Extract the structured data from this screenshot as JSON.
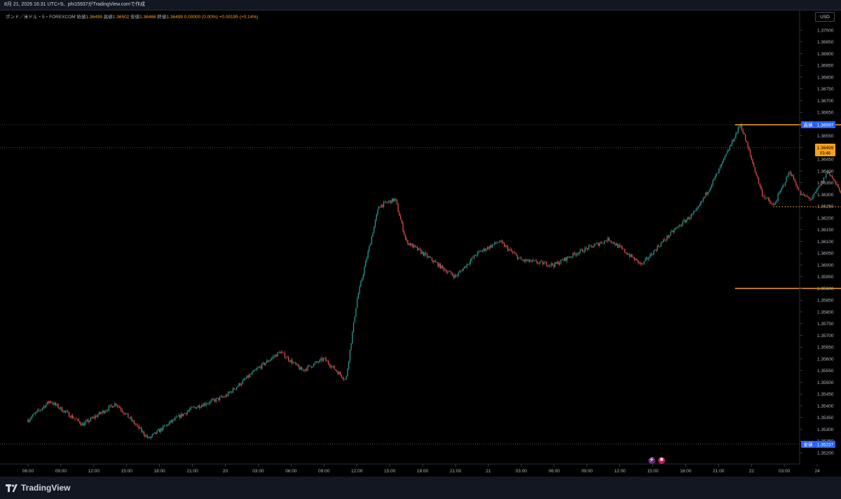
{
  "header": {
    "caption": "8月 21, 2026 16:31 UTC+9、phi15937がTradingView.comで作成"
  },
  "legend": {
    "symbol": "ポンド／米ドル・5・FOREXCOM",
    "open_label": "始値",
    "open": "1.36499",
    "high_label": "高値",
    "high": "1.36502",
    "low_label": "安値",
    "low": "1.36466",
    "close_label": "終値",
    "close": "1.36499",
    "change": "0.00000 (0.00%)",
    "change2": "+0.00195 (+0.14%)"
  },
  "price_scale": {
    "currency": "USD"
  },
  "markers": {
    "high_label": "高値",
    "high_value": "1.36597",
    "low_label": "安値",
    "low_value": "1.35237",
    "last_value": "1.36499",
    "countdown": "03:46"
  },
  "footer": {
    "logo_text": "TradingView"
  },
  "colors": {
    "up": "#26a69a",
    "down": "#ef5350",
    "accent": "#f7a21b",
    "marker": "#2962ff"
  },
  "chart_data": {
    "type": "candlestick",
    "title": "ポンド／米ドル・5・FOREXCOM",
    "y_ticks": [
      "1.37000",
      "1.36950",
      "1.36900",
      "1.36850",
      "1.36800",
      "1.36750",
      "1.36700",
      "1.36650",
      "1.36600",
      "1.36550",
      "1.36500",
      "1.36450",
      "1.36400",
      "1.36350",
      "1.36300",
      "1.36250",
      "1.36200",
      "1.36150",
      "1.36100",
      "1.36050",
      "1.36000",
      "1.35950",
      "1.35900",
      "1.35850",
      "1.35800",
      "1.35750",
      "1.35700",
      "1.35650",
      "1.35600",
      "1.35550",
      "1.35500",
      "1.35450",
      "1.35400",
      "1.35350",
      "1.35300",
      "1.35250",
      "1.35200"
    ],
    "x_ticks": [
      "06:00",
      "09:00",
      "12:00",
      "15:00",
      "18:00",
      "21:00",
      "20",
      "03:00",
      "06:00",
      "09:00",
      "12:00",
      "15:00",
      "18:00",
      "21:00",
      "21",
      "03:00",
      "06:00",
      "09:00",
      "12:00",
      "15:00",
      "18:00",
      "21:00",
      "22",
      "03:00",
      "24"
    ],
    "ylim": [
      1.3515,
      1.3715
    ],
    "price_path": [
      {
        "t": 0,
        "p": 1.3534
      },
      {
        "t": 2,
        "p": 1.3542
      },
      {
        "t": 5,
        "p": 1.3532
      },
      {
        "t": 8,
        "p": 1.3541
      },
      {
        "t": 11,
        "p": 1.3526
      },
      {
        "t": 13,
        "p": 1.3533
      },
      {
        "t": 15,
        "p": 1.3539
      },
      {
        "t": 18,
        "p": 1.3544
      },
      {
        "t": 21,
        "p": 1.3556
      },
      {
        "t": 23,
        "p": 1.3563
      },
      {
        "t": 25,
        "p": 1.3555
      },
      {
        "t": 27,
        "p": 1.356
      },
      {
        "t": 29,
        "p": 1.3551
      },
      {
        "t": 30,
        "p": 1.3585
      },
      {
        "t": 32,
        "p": 1.3625
      },
      {
        "t": 33.5,
        "p": 1.3628
      },
      {
        "t": 34.5,
        "p": 1.361
      },
      {
        "t": 36,
        "p": 1.3605
      },
      {
        "t": 38,
        "p": 1.3598
      },
      {
        "t": 39,
        "p": 1.3595
      },
      {
        "t": 41,
        "p": 1.3605
      },
      {
        "t": 43,
        "p": 1.361
      },
      {
        "t": 45,
        "p": 1.3602
      },
      {
        "t": 48,
        "p": 1.36
      },
      {
        "t": 50,
        "p": 1.3605
      },
      {
        "t": 53,
        "p": 1.3611
      },
      {
        "t": 56,
        "p": 1.36
      },
      {
        "t": 57.5,
        "p": 1.3608
      },
      {
        "t": 59,
        "p": 1.3615
      },
      {
        "t": 61,
        "p": 1.3623
      },
      {
        "t": 63,
        "p": 1.364
      },
      {
        "t": 65,
        "p": 1.366
      },
      {
        "t": 66,
        "p": 1.3645
      },
      {
        "t": 67,
        "p": 1.363
      },
      {
        "t": 68,
        "p": 1.3625
      },
      {
        "t": 69.5,
        "p": 1.364
      },
      {
        "t": 70.5,
        "p": 1.363
      },
      {
        "t": 71.5,
        "p": 1.3628
      },
      {
        "t": 73,
        "p": 1.364
      },
      {
        "t": 74,
        "p": 1.3632
      },
      {
        "t": 76,
        "p": 1.3627
      },
      {
        "t": 78,
        "p": 1.3626
      },
      {
        "t": 80,
        "p": 1.3625
      },
      {
        "t": 82,
        "p": 1.363
      },
      {
        "t": 84,
        "p": 1.363
      },
      {
        "t": 86,
        "p": 1.3635
      },
      {
        "t": 88,
        "p": 1.3638
      },
      {
        "t": 90,
        "p": 1.3645
      },
      {
        "t": 91,
        "p": 1.3641
      },
      {
        "t": 92.5,
        "p": 1.3648
      },
      {
        "t": 93.5,
        "p": 1.3654
      },
      {
        "t": 95,
        "p": 1.3648
      },
      {
        "t": 96.5,
        "p": 1.3642
      },
      {
        "t": 98,
        "p": 1.3645
      },
      {
        "t": 99,
        "p": 1.3648
      },
      {
        "t": 100,
        "p": 1.3644
      },
      {
        "t": 101.5,
        "p": 1.3649
      }
    ],
    "lines": [
      {
        "kind": "solid",
        "price": 1.36597,
        "start": 64.5,
        "end": 105
      },
      {
        "kind": "solid",
        "price": 1.359,
        "start": 64.5,
        "end": 105
      },
      {
        "kind": "dotted",
        "price": 1.36248,
        "start": 68,
        "end": 105
      }
    ]
  }
}
